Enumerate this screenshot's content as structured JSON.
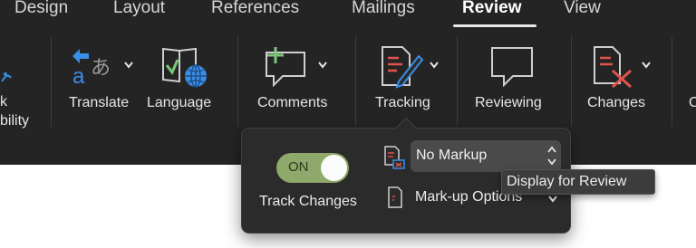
{
  "tabs": [
    {
      "label": "Design",
      "active": false
    },
    {
      "label": "Layout",
      "active": false
    },
    {
      "label": "References",
      "active": false
    },
    {
      "label": "Mailings",
      "active": false
    },
    {
      "label": "Review",
      "active": true
    },
    {
      "label": "View",
      "active": false
    }
  ],
  "ribbon": {
    "accessibility_label_line1": "k",
    "accessibility_label_line2": "bility",
    "translate_label": "Translate",
    "language_label": "Language",
    "comments_label": "Comments",
    "tracking_label": "Tracking",
    "reviewing_label": "Reviewing",
    "changes_label": "Changes",
    "next_group_partial": "C",
    "translate_glyph_latin": "a",
    "translate_glyph_jp": "あ"
  },
  "tracking_popover": {
    "toggle_text": "ON",
    "toggle_state": "on",
    "track_changes_label": "Track Changes",
    "display_for_review_value": "No Markup",
    "markup_options_label": "Mark-up Options"
  },
  "tooltip": {
    "text": "Display for Review"
  },
  "colors": {
    "ribbon_bg": "#242424",
    "toggle_on": "#8fa86b",
    "accent_red": "#e0534c",
    "accent_blue": "#3a8ee6",
    "icon_green": "#7bc67b"
  },
  "icons": [
    "accessibility-icon",
    "translate-icon",
    "language-icon",
    "comments-icon",
    "tracking-icon",
    "reviewing-icon",
    "changes-icon",
    "display-for-review-icon",
    "markup-options-icon"
  ]
}
